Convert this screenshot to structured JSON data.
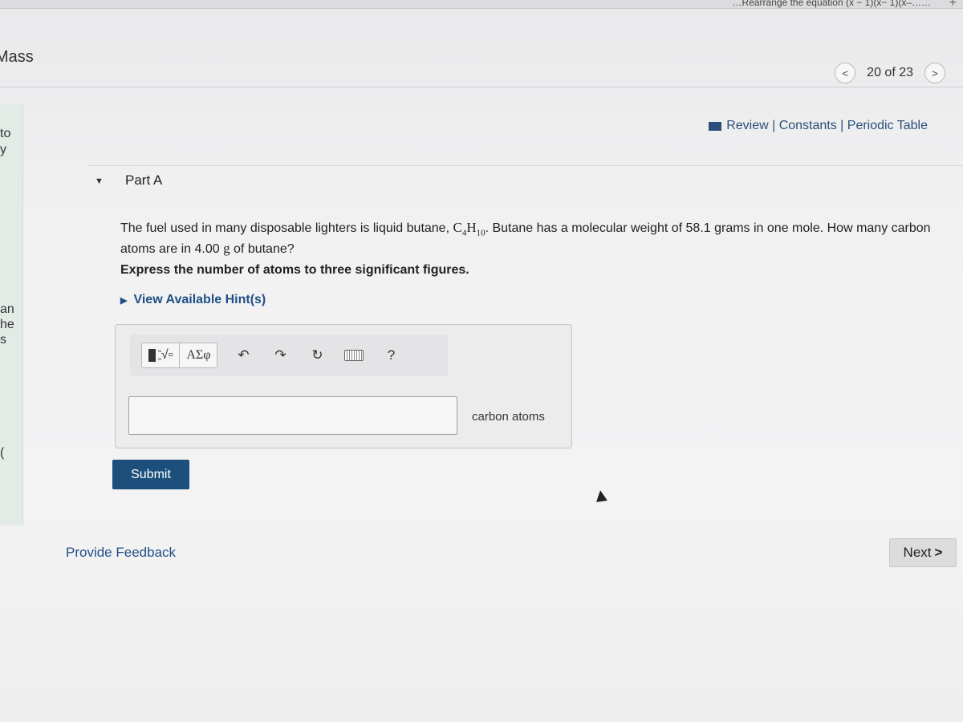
{
  "topbar": {
    "fragment": "…Rearrange the equation (x − 1)(x− 1)(x–……",
    "plus": "+"
  },
  "header": {
    "title_fragment": "Mass",
    "nav": {
      "prev": "<",
      "count": "20 of 23",
      "next": ">"
    },
    "resources": "Review | Constants | Periodic Table"
  },
  "sidebar": {
    "fragments": [
      "to",
      "y",
      "an",
      "he",
      "s",
      "("
    ]
  },
  "part": {
    "label": "Part A",
    "question_pre": "The fuel used in many disposable lighters is liquid butane, ",
    "formula_c": "C",
    "formula_c_sub": "4",
    "formula_h": "H",
    "formula_h_sub": "10",
    "question_mid": ". Butane has a molecular weight of 58.1 grams in one mole. How many carbon atoms are in 4.00 ",
    "unit_g": "g",
    "question_post": " of butane?",
    "instruction": "Express the number of atoms to three significant figures.",
    "hints_label": "View Available Hint(s)"
  },
  "toolbar": {
    "template_label": "√",
    "greek_label": "ΑΣφ",
    "undo": "↶",
    "redo": "↷",
    "reset": "↻",
    "help": "?"
  },
  "answer": {
    "value": "",
    "unit_label": "carbon atoms"
  },
  "buttons": {
    "submit": "Submit",
    "feedback": "Provide Feedback",
    "next": "Next",
    "next_chevron": ">"
  }
}
